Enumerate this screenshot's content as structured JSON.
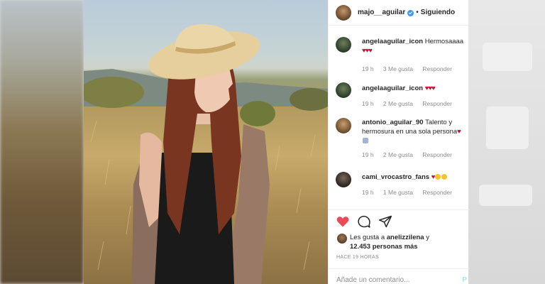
{
  "post": {
    "username": "majo__aguilar",
    "separator": "•",
    "follow_status": "Siguiendo"
  },
  "comments": [
    {
      "user": "angelaaguilar_icon",
      "text": "Hermosaaaa",
      "hearts": "♥♥♥",
      "time": "19 h",
      "likes": "3 Me gusta",
      "reply": "Responder"
    },
    {
      "user": "angelaaguilar_icon",
      "text": "",
      "hearts": "♥♥♥",
      "time": "19 h",
      "likes": "2 Me gusta",
      "reply": "Responder"
    },
    {
      "user": "antonio_aguilar_90",
      "text": "Talento y hermosura en una sola persona",
      "hearts": "♥",
      "time": "19 h",
      "likes": "2 Me gusta",
      "reply": "Responder"
    },
    {
      "user": "cami_vrocastro_fans",
      "text": "",
      "hearts": "♥",
      "time": "19 h",
      "likes": "1 Me gusta",
      "reply": "Responder"
    }
  ],
  "likes": {
    "prefix": "Les gusta a",
    "user": "anelizzilena",
    "connector": "y",
    "count": "12.453 personas más"
  },
  "timestamp": "HACE 19 HORAS",
  "comment_input": {
    "placeholder": "Añade un comentario...",
    "publish": "P"
  },
  "colors": {
    "heart": "#ed4956",
    "link": "#3897f0",
    "muted": "#8e8e8e"
  },
  "icons": [
    "heart-icon",
    "comment-icon",
    "share-icon",
    "verified-icon"
  ]
}
